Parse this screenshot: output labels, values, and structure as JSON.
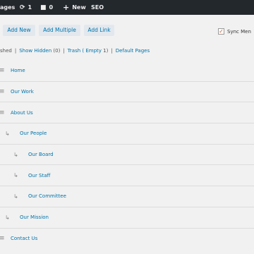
{
  "adminbar": {
    "pages_label": "ages",
    "updates_count": "1",
    "comments_count": "0",
    "new_label": "New",
    "seo_label": "SEO"
  },
  "toolbar": {
    "add_new": "Add New",
    "add_multiple": "Add Multiple",
    "add_link": "Add Link",
    "sync_label": "Sync Men"
  },
  "filter": {
    "published": "shed",
    "show_hidden": "Show Hidden",
    "show_hidden_count": "(0)",
    "trash": "Trash",
    "trash_empty": "( Empty",
    "trash_count": "1)",
    "default_pages": "Default Pages"
  },
  "tree": [
    {
      "title": "Home",
      "level": 0
    },
    {
      "title": "Our Work",
      "level": 0
    },
    {
      "title": "About Us",
      "level": 0
    },
    {
      "title": "Our People",
      "level": 1
    },
    {
      "title": "Our Board",
      "level": 2
    },
    {
      "title": "Our Staff",
      "level": 2
    },
    {
      "title": "Our Committee",
      "level": 2
    },
    {
      "title": "Our Mission",
      "level": 1
    },
    {
      "title": "Contact Us",
      "level": 0
    }
  ],
  "colors": {
    "adminbar_bg": "#23282d",
    "link": "#0073aa",
    "button_bg": "#e2e8ee",
    "page_bg": "#f1f1f1"
  }
}
